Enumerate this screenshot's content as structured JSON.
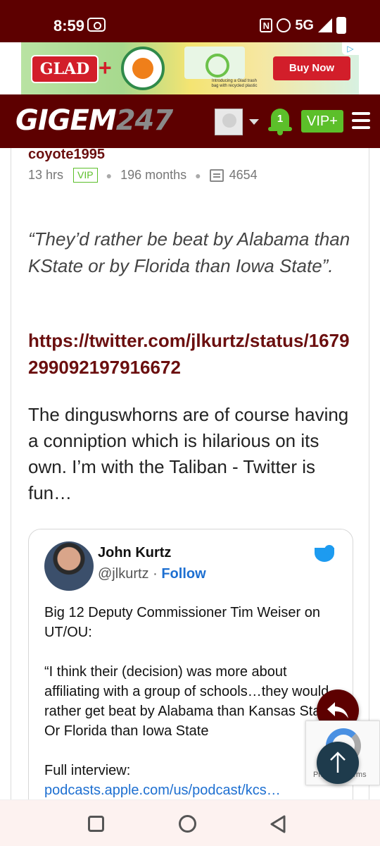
{
  "status_bar": {
    "time": "8:59",
    "network": "5G"
  },
  "ad": {
    "brand": "GLAD",
    "plus": "+",
    "caption": "Introducing a Glad trash bag with recycled plastic",
    "cta": "Buy Now",
    "adchoices": "▷"
  },
  "header": {
    "logo_main": "GIGEM",
    "logo_num": "247",
    "notification_count": "1",
    "vip_label": "VIP+"
  },
  "post": {
    "username": "coyote1995",
    "time_ago": "13 hrs",
    "badge": "VIP",
    "membership": "196 months",
    "post_count": "4654",
    "quote": "“They’d rather be beat by Alabama than KState or by Florida than Iowa State”.",
    "link": "https://twitter.com/jlkurtz/status/1679299092197916672",
    "text": "The dinguswhorns are of course having a conniption which is hilarious on its own. I’m with the Taliban - Twitter is fun…"
  },
  "tweet": {
    "name": "John Kurtz",
    "handle": "@jlkurtz",
    "separator": "·",
    "follow": "Follow",
    "para1": "Big 12 Deputy Commissioner Tim Weiser on UT/OU:",
    "para2": "“I think their (decision) was more about affiliating with a group of schools…they would rather get beat by Alabama than Kansas State. Or Florida than Iowa State",
    "para3": "Full interview:",
    "link": "podcasts.apple.com/us/podcast/kcs…"
  },
  "recaptcha": {
    "text": "Privacy - Terms"
  },
  "colors": {
    "maroon": "#5d0000",
    "green": "#5cbf2a",
    "link_blue": "#1d6fd1"
  }
}
